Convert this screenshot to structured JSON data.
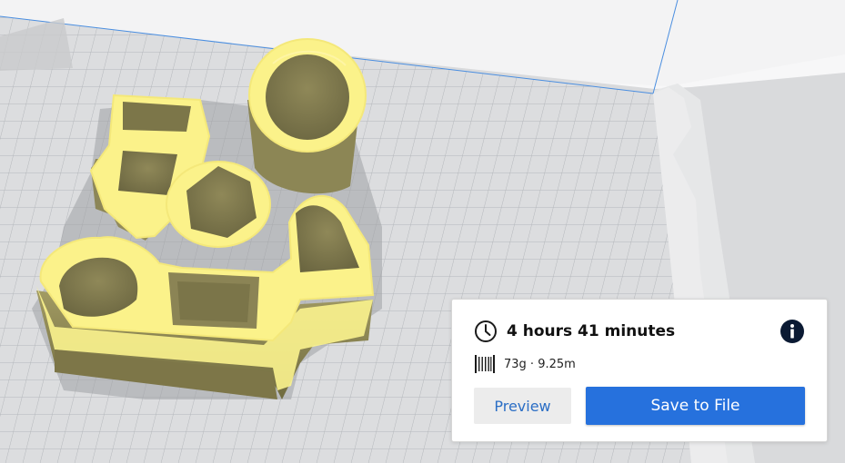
{
  "print_summary": {
    "time_label": "4 hours 41 minutes",
    "material_label": "73g · 9.25m",
    "info_icon": "info-icon",
    "clock_icon": "clock-icon",
    "spool_icon": "filament-spool-icon"
  },
  "actions": {
    "preview_label": "Preview",
    "save_label": "Save to File"
  },
  "colors": {
    "accent": "#2671dd",
    "model": "#fbf28a",
    "model_shadow": "#8a8352",
    "build_plate_grid": "#b9bcc0"
  }
}
